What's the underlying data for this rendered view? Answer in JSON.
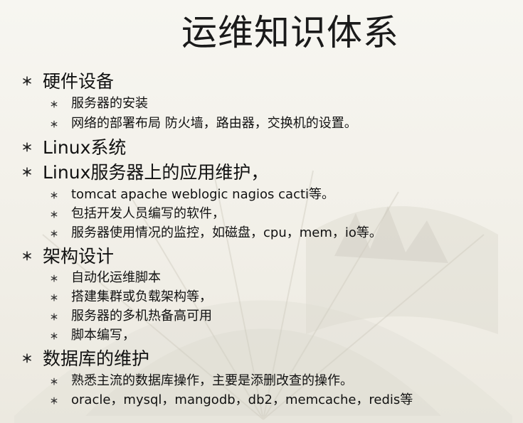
{
  "slide": {
    "title": "运维知识体系",
    "bullet_glyph": "＊",
    "items": [
      {
        "text": "硬件设备",
        "children": [
          "服务器的安装",
          "网络的部署布局 防火墙，路由器，交换机的设置。"
        ]
      },
      {
        "text": "Linux系统",
        "children": []
      },
      {
        "text": "Linux服务器上的应用维护，",
        "children": [
          "tomcat apache weblogic nagios cacti等。",
          "包括开发人员编写的软件，",
          "服务器使用情况的监控，如磁盘，cpu，mem，io等。"
        ]
      },
      {
        "text": "架构设计",
        "children": [
          "自动化运维脚本",
          "搭建集群或负载架构等，",
          "服务器的多机热备高可用",
          "脚本编写，"
        ]
      },
      {
        "text": "数据库的维护",
        "children": [
          "熟悉主流的数据库操作，主要是添删改查的操作。",
          "oracle，mysql，mangodb，db2，memcache，redis等"
        ]
      }
    ]
  },
  "theme": {
    "background": "#f4f2ec",
    "text": "#111111",
    "fan": "#d9d6cc"
  }
}
